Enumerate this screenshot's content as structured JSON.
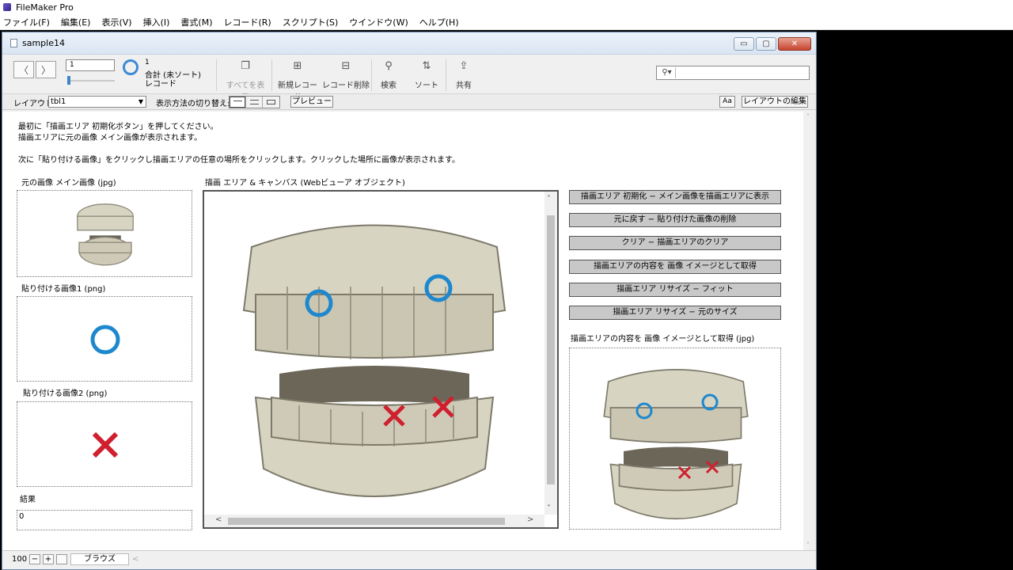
{
  "app": {
    "title": "FileMaker Pro"
  },
  "menu": [
    "ファイル(F)",
    "編集(E)",
    "表示(V)",
    "挿入(I)",
    "書式(M)",
    "レコード(R)",
    "スクリプト(S)",
    "ウインドウ(W)",
    "ヘルプ(H)"
  ],
  "window": {
    "title": "sample14",
    "min_glyph": "▭",
    "max_glyph": "▢",
    "close_glyph": "✕"
  },
  "toolbar": {
    "record_number": "1",
    "found_count": "1",
    "total_label": "合計 (未ソート)",
    "records_label": "レコード",
    "show_all": "すべてを表示",
    "new_record": "新規レコード",
    "delete_record": "レコード削除",
    "find": "検索",
    "sort": "ソート",
    "share": "共有",
    "prev_glyph": "〈",
    "next_glyph": "〉",
    "show_all_glyph": "❐",
    "new_glyph": "⊞",
    "delete_glyph": "⊟",
    "find_glyph": "⚲",
    "sort_glyph": "⇅",
    "share_glyph": "⇪",
    "search_glyph": "⚲▾"
  },
  "layoutbar": {
    "layout_label": "レイアウト:",
    "layout_value": "tbl1",
    "dropdown_glyph": "▼",
    "view_as_label": "表示方法の切り替え:",
    "preview": "プレビュー",
    "aa": "Aa",
    "edit_layout": "レイアウトの編集"
  },
  "instructions": [
    "最初に「描画エリア 初期化ボタン」を押してください。",
    "描画エリアに元の画像 メイン画像が表示されます。",
    "次に「貼り付ける画像」をクリックし描画エリアの任意の場所をクリックします。クリックした場所に画像が表示されます。"
  ],
  "labels": {
    "original_image": "元の画像 メイン画像 (jpg)",
    "paste_image_1": "貼り付ける画像1 (png)",
    "paste_image_2": "貼り付ける画像2 (png)",
    "result": "結果",
    "canvas": "描画 エリア & キャンバス (Webビューア オブジェクト)",
    "captured": "描画エリアの内容を 画像 イメージとして取得 (jpg)"
  },
  "result_value": "0",
  "scroll": {
    "up": "˄",
    "down": "˅",
    "left": "<",
    "right": ">"
  },
  "buttons": [
    "描画エリア 初期化 − メイン画像を描画エリアに表示",
    "元に戻す − 貼り付けた画像の削除",
    "クリア − 描画エリアのクリア",
    "描画エリアの内容を 画像 イメージとして取得",
    "描画エリア リサイズ − フィット",
    "描画エリア リサイズ − 元のサイズ"
  ],
  "status": {
    "zoom": "100",
    "zoom_out": "−",
    "zoom_in": "+",
    "mode": "ブラウズ",
    "left": "<"
  },
  "colors": {
    "ring": "#1e88cf",
    "cross": "#d01f2e",
    "tooth": "#d8d4c2"
  }
}
